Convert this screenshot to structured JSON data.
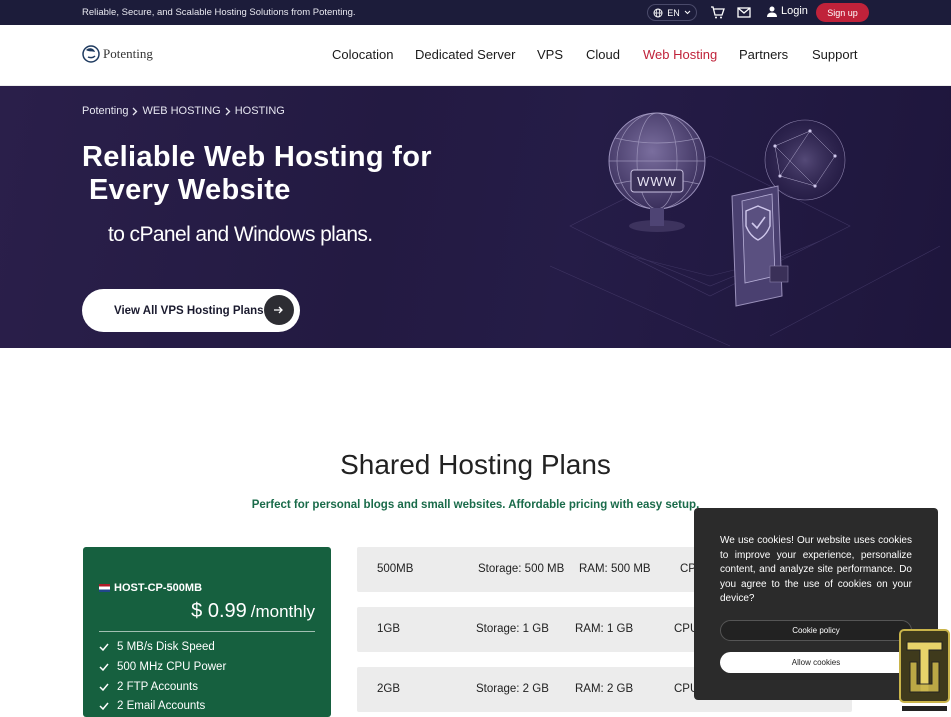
{
  "topbar": {
    "tagline": "Reliable, Secure, and Scalable Hosting Solutions from Potenting.",
    "lang": "EN",
    "login": "Login",
    "signup": "Sign up"
  },
  "logo": {
    "name": "Potenting"
  },
  "nav": {
    "items": [
      "Colocation",
      "Dedicated Server",
      "VPS",
      "Cloud",
      "Web Hosting",
      "Partners",
      "Support"
    ],
    "active": "Web Hosting"
  },
  "hero": {
    "breadcrumb": [
      "Potenting",
      "WEB HOSTING",
      "HOSTING"
    ],
    "title_line1": "Reliable Web Hosting for",
    "title_line2": "Every Website",
    "subtitle": "to cPanel and Windows plans.",
    "cta": "View All VPS Hosting Plans",
    "globe_label": "WWW"
  },
  "plans": {
    "title": "Shared Hosting Plans",
    "subtitle": "Perfect for personal blogs and small websites. Affordable pricing with easy setup.",
    "featured": {
      "name": "HOST-CP-500MB",
      "price": "$ 0.99",
      "period": "/monthly",
      "features": [
        "5 MB/s Disk Speed",
        "500 MHz CPU Power",
        "2 FTP Accounts",
        "2 Email Accounts"
      ]
    },
    "rows": [
      {
        "name": "500MB",
        "storage": "Storage: 500 MB",
        "ram": "RAM: 500 MB",
        "cpu": "CP"
      },
      {
        "name": "1GB",
        "storage": "Storage: 1 GB",
        "ram": "RAM: 1 GB",
        "cpu": "CPU"
      },
      {
        "name": "2GB",
        "storage": "Storage: 2 GB",
        "ram": "RAM: 2 GB",
        "cpu": "CPU"
      }
    ]
  },
  "cookie": {
    "text": "We use cookies! Our website uses cookies to improve your experience, personalize content, and analyze site performance. Do you agree to the use of cookies on your device?",
    "policy": "Cookie policy",
    "allow": "Allow cookies"
  },
  "colors": {
    "topbar": "#1c1c3a",
    "accent": "#c0223a",
    "plan_green": "#16603f",
    "hero_bg": "#251c47"
  }
}
